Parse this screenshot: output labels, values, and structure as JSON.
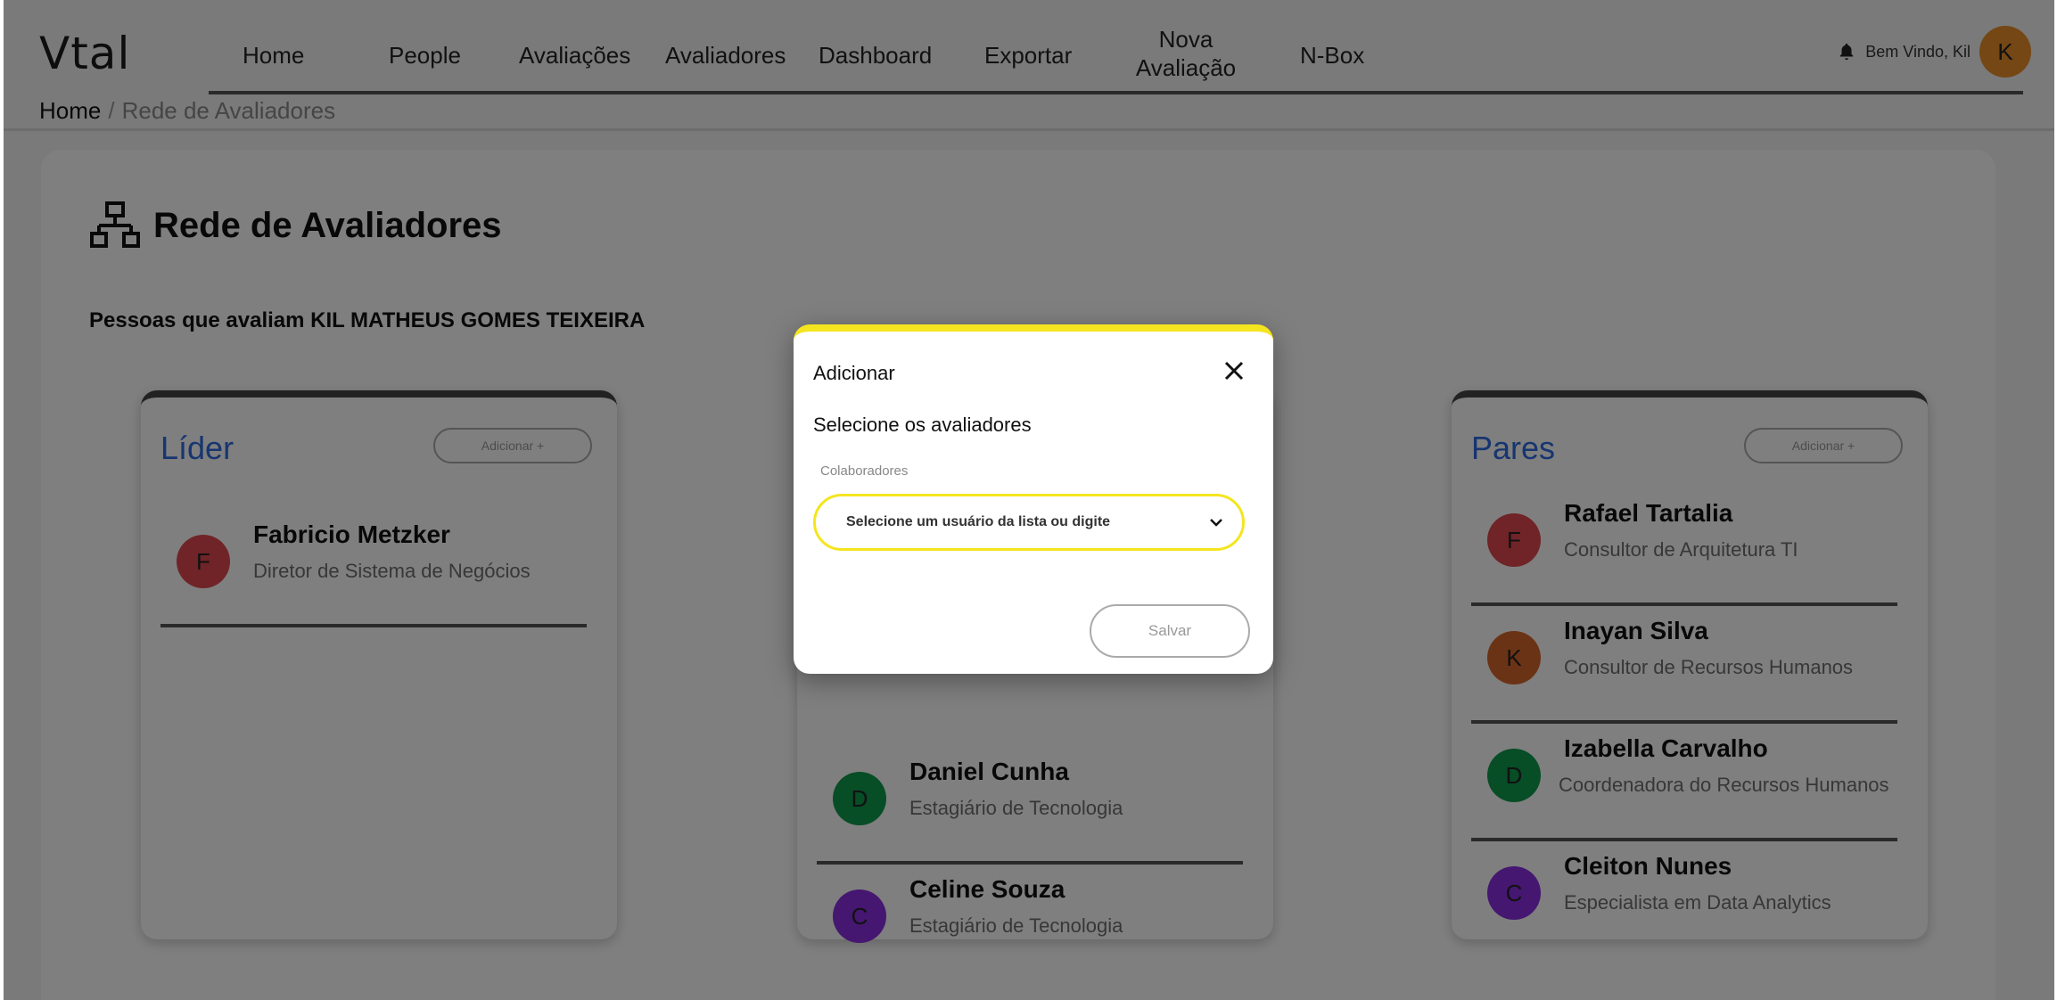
{
  "nav": {
    "logo": "Vtal",
    "items": [
      {
        "label": "Home"
      },
      {
        "label": "People"
      },
      {
        "label": "Avaliações"
      },
      {
        "label": "Avaliadores"
      },
      {
        "label": "Dashboard"
      },
      {
        "label": "Exportar"
      },
      {
        "label": "Nova Avaliação"
      },
      {
        "label": "N-Box"
      }
    ],
    "welcome": "Bem Vindo, Kil",
    "avatar_initial": "K"
  },
  "breadcrumb": {
    "home": "Home",
    "separator": "/",
    "current": "Rede de Avaliadores"
  },
  "page": {
    "title": "Rede de Avaliadores",
    "subtitle": "Pessoas que avaliam KIL MATHEUS GOMES TEIXEIRA"
  },
  "groups": {
    "lider": {
      "title": "Líder",
      "add_label": "Adicionar +",
      "people": [
        {
          "initial": "F",
          "name": "Fabricio Metzker",
          "role": "Diretor de Sistema de Negócios",
          "color": "#e0484f"
        }
      ]
    },
    "middle": {
      "people": [
        {
          "initial": "D",
          "name": "Daniel Cunha",
          "role": "Estagiário de Tecnologia",
          "color": "#0e9a4c"
        },
        {
          "initial": "C",
          "name": "Celine Souza",
          "role": "Estagiário de Tecnologia",
          "color": "#8a2fe0"
        }
      ]
    },
    "pares": {
      "title": "Pares",
      "add_label": "Adicionar +",
      "people": [
        {
          "initial": "F",
          "name": "Rafael Tartalia",
          "role": "Consultor de Arquitetura TI",
          "color": "#e0484f"
        },
        {
          "initial": "K",
          "name": "Inayan Silva",
          "role": "Consultor de Recursos Humanos",
          "color": "#d7662b"
        },
        {
          "initial": "D",
          "name": "Izabella Carvalho",
          "role": "Coordenadora do Recursos Humanos",
          "color": "#0e9a4c"
        },
        {
          "initial": "C",
          "name": "Cleiton Nunes",
          "role": "Especialista em Data Analytics",
          "color": "#8a2fe0"
        }
      ]
    }
  },
  "modal": {
    "title": "Adicionar",
    "label": "Selecione os avaliadores",
    "field_label": "Colaboradores",
    "placeholder": "Selecione um usuário da lista ou digite",
    "save_label": "Salvar",
    "accent_color": "#f5e51f"
  },
  "colors": {
    "brand_blue": "#2e6ae0",
    "avatar_main": "#e98f2a"
  }
}
